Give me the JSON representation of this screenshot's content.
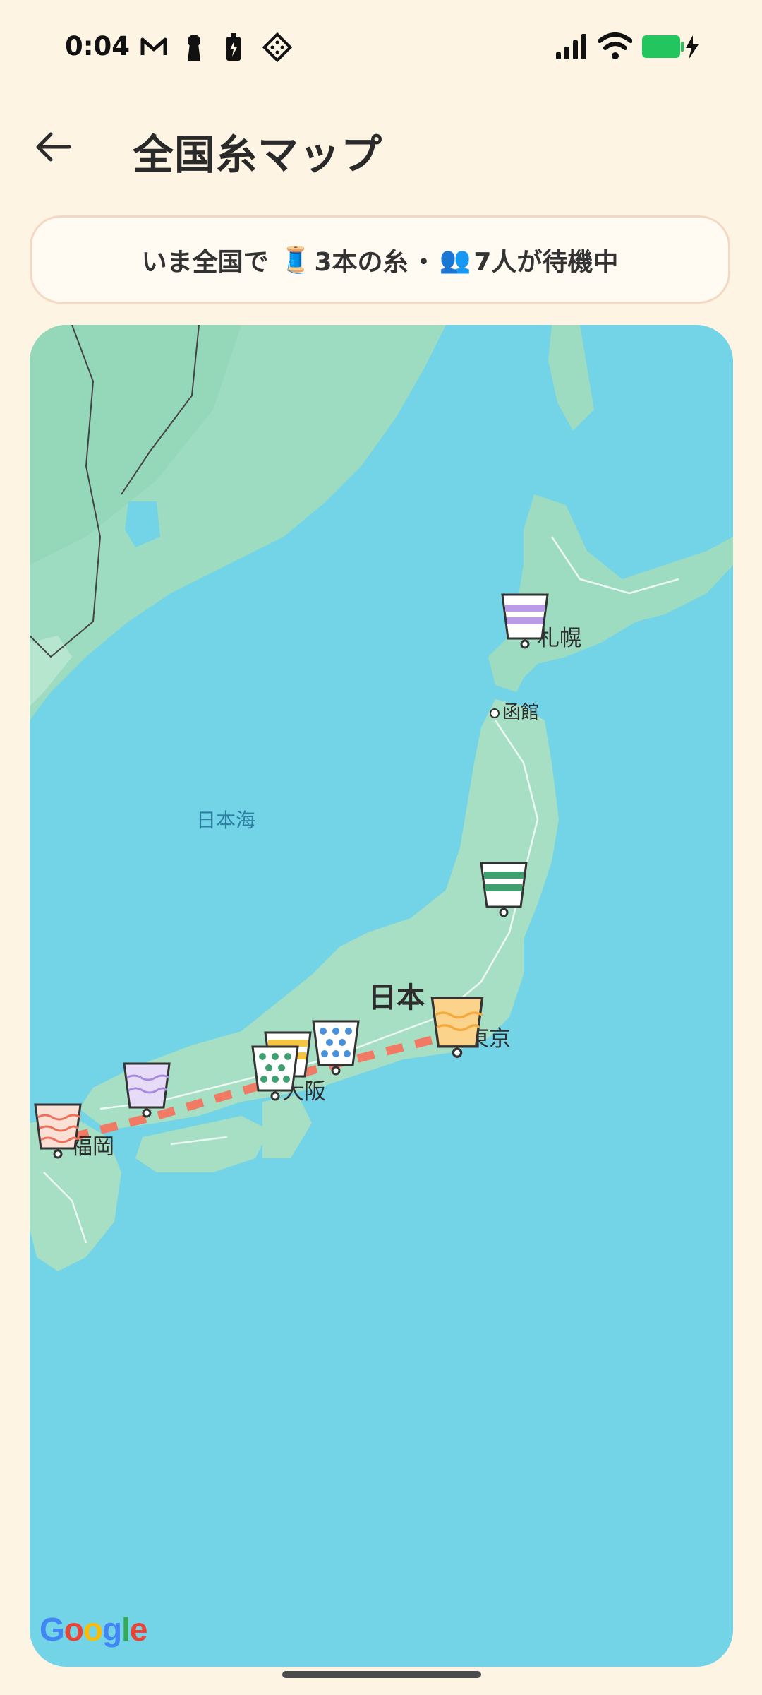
{
  "status_bar": {
    "time": "0:04"
  },
  "app_bar": {
    "title": "全国糸マップ"
  },
  "banner": {
    "prefix": "いま全国で",
    "spool_emoji": "🧵",
    "threads": "3本の糸",
    "separator": "・",
    "people_emoji": "👥",
    "waiting": "7人が待機中"
  },
  "map": {
    "labels": {
      "sapporo": "札幌",
      "hakodate": "函館",
      "sea_of_japan": "日本海",
      "japan": "日本",
      "tokyo": "東京",
      "osaka": "大阪",
      "fukuoka": "福岡"
    },
    "attribution": "Google",
    "route_color": "#f07a64"
  }
}
